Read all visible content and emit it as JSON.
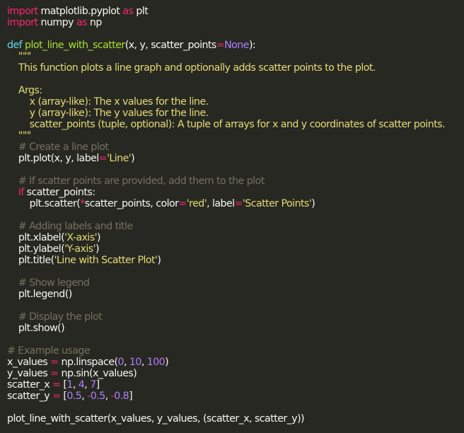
{
  "colors": {
    "background": "#272822",
    "text": "#f8f8f2",
    "keyword": "#f92672",
    "def_keyword": "#66d9ef",
    "function": "#a6e22e",
    "string": "#e6db74",
    "number": "#ae81ff",
    "comment": "#75715e"
  },
  "code_lines": [
    [
      [
        "kw",
        "import"
      ],
      [
        "t",
        " matplotlib.pyplot "
      ],
      [
        "kw",
        "as"
      ],
      [
        "t",
        " plt"
      ]
    ],
    [
      [
        "kw",
        "import"
      ],
      [
        "t",
        " numpy "
      ],
      [
        "kw",
        "as"
      ],
      [
        "t",
        " np"
      ]
    ],
    [],
    [
      [
        "def",
        "def "
      ],
      [
        "fn",
        "plot_line_with_scatter"
      ],
      [
        "t",
        "(x, y, scatter_points"
      ],
      [
        "op",
        "="
      ],
      [
        "const",
        "None"
      ],
      [
        "t",
        "):"
      ]
    ],
    [
      [
        "doc",
        "    \"\"\""
      ]
    ],
    [
      [
        "doc",
        "    This function plots a line graph and optionally adds scatter points to the plot."
      ]
    ],
    [],
    [
      [
        "doc",
        "    Args:"
      ]
    ],
    [
      [
        "doc",
        "        x (array-like): The x values for the line."
      ]
    ],
    [
      [
        "doc",
        "        y (array-like): The y values for the line."
      ]
    ],
    [
      [
        "doc",
        "        scatter_points (tuple, optional): A tuple of arrays for x and y coordinates of scatter points."
      ]
    ],
    [
      [
        "doc",
        "    \"\"\""
      ]
    ],
    [
      [
        "com",
        "    # Create a line plot"
      ]
    ],
    [
      [
        "t",
        "    plt.plot(x, y, label"
      ],
      [
        "op",
        "="
      ],
      [
        "str",
        "'Line'"
      ],
      [
        "t",
        ")"
      ]
    ],
    [],
    [
      [
        "com",
        "    # If scatter points are provided, add them to the plot"
      ]
    ],
    [
      [
        "t",
        "    "
      ],
      [
        "kw",
        "if"
      ],
      [
        "t",
        " scatter_points:"
      ]
    ],
    [
      [
        "t",
        "        plt.scatter("
      ],
      [
        "op",
        "*"
      ],
      [
        "t",
        "scatter_points, color"
      ],
      [
        "op",
        "="
      ],
      [
        "str",
        "'red'"
      ],
      [
        "t",
        ", label"
      ],
      [
        "op",
        "="
      ],
      [
        "str",
        "'Scatter Points'"
      ],
      [
        "t",
        ")"
      ]
    ],
    [],
    [
      [
        "com",
        "    # Adding labels and title"
      ]
    ],
    [
      [
        "t",
        "    plt.xlabel("
      ],
      [
        "str",
        "'X-axis'"
      ],
      [
        "t",
        ")"
      ]
    ],
    [
      [
        "t",
        "    plt.ylabel("
      ],
      [
        "str",
        "'Y-axis'"
      ],
      [
        "t",
        ")"
      ]
    ],
    [
      [
        "t",
        "    plt.title("
      ],
      [
        "str",
        "'Line with Scatter Plot'"
      ],
      [
        "t",
        ")"
      ]
    ],
    [],
    [
      [
        "com",
        "    # Show legend"
      ]
    ],
    [
      [
        "t",
        "    plt.legend()"
      ]
    ],
    [],
    [
      [
        "com",
        "    # Display the plot"
      ]
    ],
    [
      [
        "t",
        "    plt.show()"
      ]
    ],
    [],
    [
      [
        "com",
        "# Example usage"
      ]
    ],
    [
      [
        "t",
        "x_values "
      ],
      [
        "op",
        "="
      ],
      [
        "t",
        " np.linspace("
      ],
      [
        "num",
        "0"
      ],
      [
        "t",
        ", "
      ],
      [
        "num",
        "10"
      ],
      [
        "t",
        ", "
      ],
      [
        "num",
        "100"
      ],
      [
        "t",
        ")"
      ]
    ],
    [
      [
        "t",
        "y_values "
      ],
      [
        "op",
        "="
      ],
      [
        "t",
        " np.sin(x_values)"
      ]
    ],
    [
      [
        "t",
        "scatter_x "
      ],
      [
        "op",
        "="
      ],
      [
        "t",
        " ["
      ],
      [
        "num",
        "1"
      ],
      [
        "t",
        ", "
      ],
      [
        "num",
        "4"
      ],
      [
        "t",
        ", "
      ],
      [
        "num",
        "7"
      ],
      [
        "t",
        "]"
      ]
    ],
    [
      [
        "t",
        "scatter_y "
      ],
      [
        "op",
        "="
      ],
      [
        "t",
        " ["
      ],
      [
        "num",
        "0.5"
      ],
      [
        "t",
        ", "
      ],
      [
        "op",
        "-"
      ],
      [
        "num",
        "0.5"
      ],
      [
        "t",
        ", "
      ],
      [
        "op",
        "-"
      ],
      [
        "num",
        "0.8"
      ],
      [
        "t",
        "]"
      ]
    ],
    [],
    [
      [
        "t",
        "plot_line_with_scatter(x_values, y_values, (scatter_x, scatter_y))"
      ]
    ]
  ]
}
